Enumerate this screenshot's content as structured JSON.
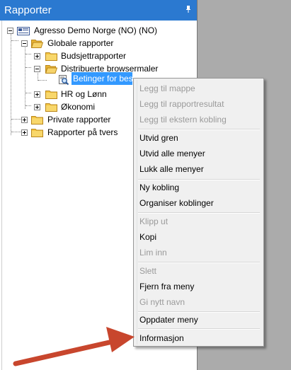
{
  "panel": {
    "title": "Rapporter",
    "pin_icon": "pin-icon"
  },
  "tree": {
    "root": {
      "label": "Agresso Demo Norge (NO) (NO)"
    },
    "global": {
      "label": "Globale rapporter"
    },
    "budsjett": {
      "label": "Budsjettrapporter"
    },
    "distribuerte": {
      "label": "Distribuerte browsermaler"
    },
    "betinger": {
      "label": "Betinger for bestill"
    },
    "hr": {
      "label": "HR og Lønn"
    },
    "okonomi": {
      "label": "Økonomi"
    },
    "private": {
      "label": "Private rapporter"
    },
    "tvers": {
      "label": "Rapporter på tvers"
    }
  },
  "colors": {
    "header": "#2b79d0",
    "selection": "#3399ff",
    "folder": "#f4c542",
    "arrow": "#c8462d"
  },
  "menu": {
    "legg_til_mappe": "Legg til mappe",
    "legg_til_rapportresultat": "Legg til rapportresultat",
    "legg_til_ekstern": "Legg til ekstern kobling",
    "utvid_gren": "Utvid gren",
    "utvid_alle": "Utvid alle menyer",
    "lukk_alle": "Lukk alle menyer",
    "ny_kobling": "Ny kobling",
    "organiser": "Organiser koblinger",
    "klipp_ut": "Klipp ut",
    "kopi": "Kopi",
    "lim_inn": "Lim inn",
    "slett": "Slett",
    "fjern": "Fjern fra meny",
    "gi_nytt_navn": "Gi nytt navn",
    "oppdater": "Oppdater meny",
    "informasjon": "Informasjon"
  }
}
